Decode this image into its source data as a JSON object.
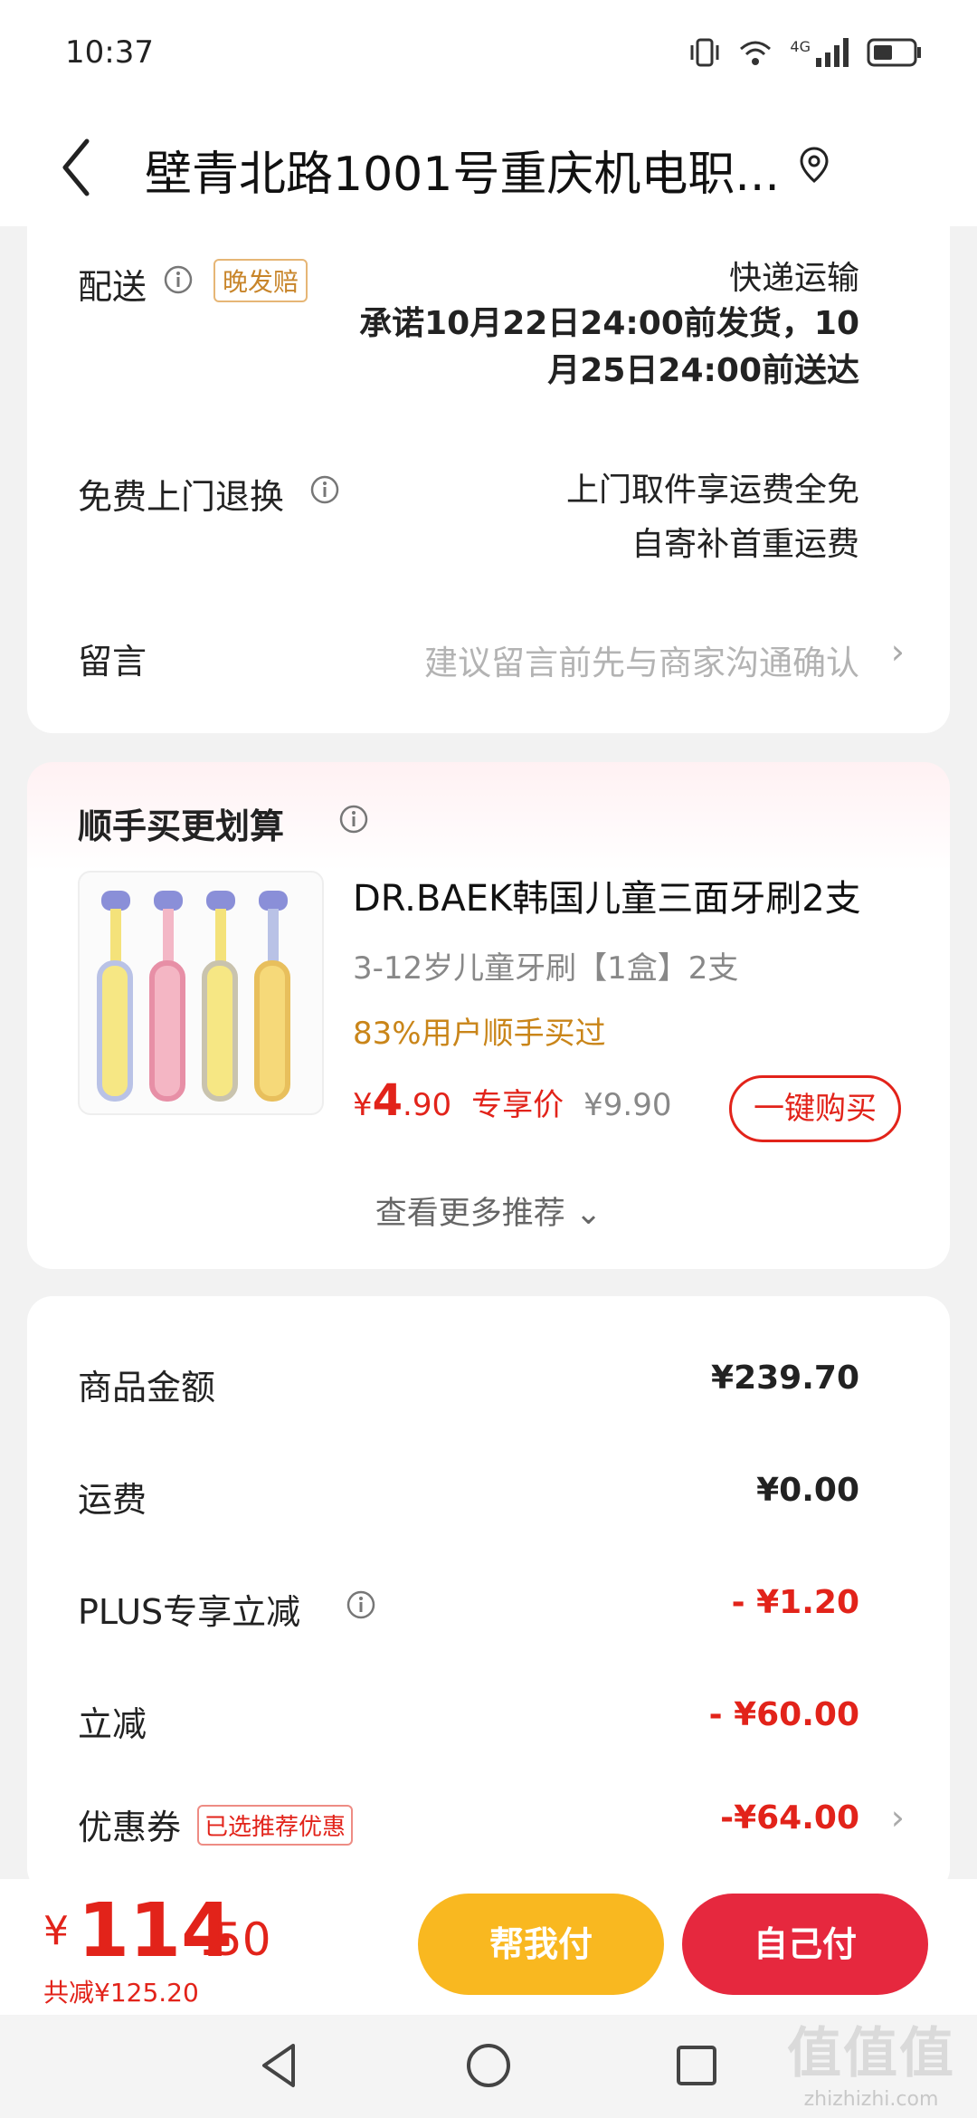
{
  "status": {
    "time": "10:37",
    "network": "4G"
  },
  "header": {
    "address": "壁青北路1001号重庆机电职..."
  },
  "delivery": {
    "label": "配送",
    "tag": "晚发赔",
    "method": "快递运输",
    "promise_line1": "承诺10月22日24:00前发货，10",
    "promise_line2": "月25日24:00前送达"
  },
  "returns": {
    "label": "免费上门退换",
    "line1": "上门取件享运费全免",
    "line2": "自寄补首重运费"
  },
  "remark": {
    "label": "留言",
    "placeholder": "建议留言前先与商家沟通确认"
  },
  "addon": {
    "title": "顺手买更划算",
    "product_name": "DR.BAEK韩国儿童三面牙刷2支",
    "spec": "3-12岁儿童牙刷【1盒】2支",
    "buyers": "83%用户顺手买过",
    "price_symbol": "¥",
    "price_int": "4",
    "price_dec": ".90",
    "price_label": "专享价",
    "old_price": "¥9.90",
    "buy_label": "一键购买",
    "more_label": "查看更多推荐 ⌄"
  },
  "summary": {
    "rows": [
      {
        "label": "商品金额",
        "value": "¥239.70"
      },
      {
        "label": "运费",
        "value": "¥0.00"
      },
      {
        "label": "PLUS专享立减",
        "value": "- ¥1.20"
      },
      {
        "label": "立减",
        "value": "- ¥60.00"
      },
      {
        "label": "优惠券",
        "tag": "已选推荐优惠",
        "value": "-¥64.00"
      }
    ]
  },
  "bottom": {
    "symbol": "¥",
    "total_int": "114",
    "total_dec": ".50",
    "saved": "共减¥125.20",
    "help_pay": "帮我付",
    "self_pay": "自己付"
  },
  "watermark": {
    "big": "值值值",
    "small": "zhizhizhi.com"
  },
  "colors": {
    "accent_red": "#e2231a",
    "help_yellow": "#f9b820",
    "self_red": "#e6283e",
    "tag_orange": "#c8852a"
  }
}
